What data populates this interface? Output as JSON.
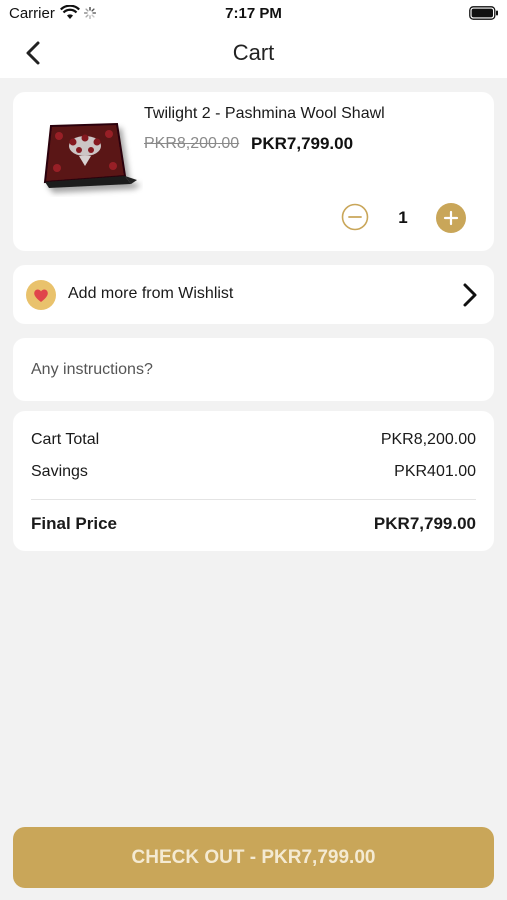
{
  "status_bar": {
    "carrier": "Carrier",
    "time": "7:17 PM"
  },
  "nav": {
    "title": "Cart"
  },
  "cart_item": {
    "name": "Twilight 2 - Pashmina Wool Shawl",
    "original_price": "PKR8,200.00",
    "sale_price": "PKR7,799.00",
    "quantity": "1"
  },
  "wishlist": {
    "label": "Add more from Wishlist"
  },
  "instructions": {
    "placeholder": "Any instructions?",
    "value": ""
  },
  "summary": {
    "cart_total_label": "Cart Total",
    "cart_total_value": "PKR8,200.00",
    "savings_label": "Savings",
    "savings_value": "PKR401.00",
    "final_label": "Final Price",
    "final_value": "PKR7,799.00"
  },
  "checkout": {
    "label": "CHECK OUT - PKR7,799.00"
  },
  "colors": {
    "accent": "#c9a659",
    "accent_text": "#f4ead2",
    "background": "#f2f2f2",
    "card": "#ffffff"
  },
  "icons": {
    "back": "chevron-left-icon",
    "minus": "minus-circle-icon",
    "plus": "plus-circle-icon",
    "wishlist": "heart-icon",
    "wishlist_chevron": "chevron-right-icon"
  }
}
